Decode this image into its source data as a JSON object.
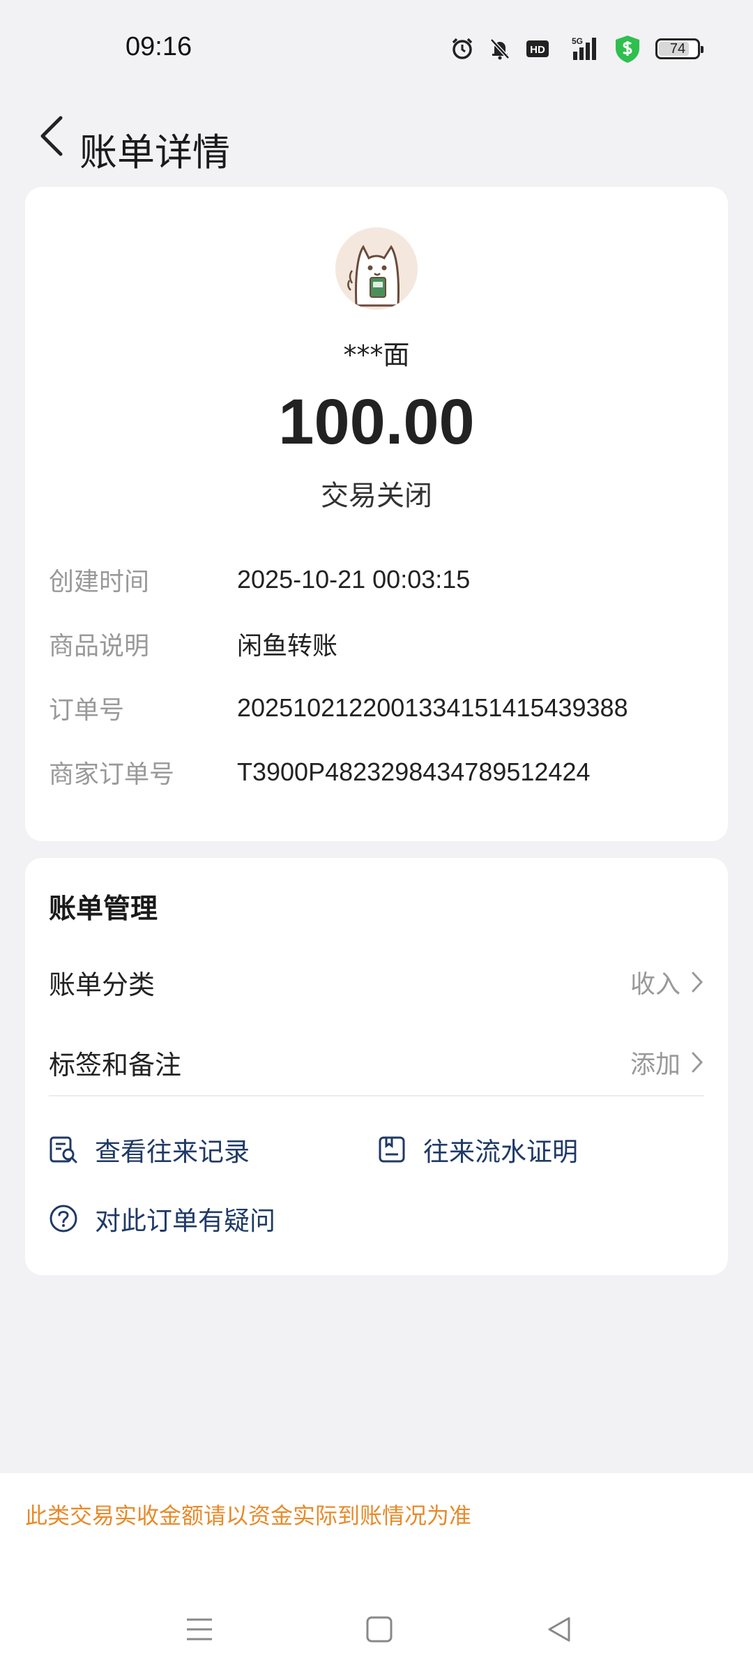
{
  "status_bar": {
    "time": "09:16",
    "icons": [
      "alarm-icon",
      "mute-bell-icon",
      "hd-icon",
      "5g-signal-icon",
      "shield-dollar-icon",
      "battery-icon"
    ],
    "hd_label": "HD",
    "network_label": "5G",
    "battery": "74",
    "battery_level": 0.74
  },
  "header": {
    "title": "账单详情"
  },
  "summary": {
    "payee": "***面",
    "amount": "100.00",
    "status": "交易关闭",
    "details": [
      {
        "label": "创建时间",
        "value": "2025-10-21 00:03:15"
      },
      {
        "label": "商品说明",
        "value": "闲鱼转账"
      },
      {
        "label": "订单号",
        "value": "2025102122001334151415439388"
      },
      {
        "label": "商家订单号",
        "value": "T3900P4823298434789512424"
      }
    ]
  },
  "manage": {
    "title": "账单管理",
    "rows": [
      {
        "label": "账单分类",
        "value": "收入"
      },
      {
        "label": "标签和备注",
        "value": "添加"
      }
    ],
    "links": [
      {
        "label": "查看往来记录",
        "icon": "record-search-icon"
      },
      {
        "label": "往来流水证明",
        "icon": "statement-icon"
      },
      {
        "label": "对此订单有疑问",
        "icon": "question-icon"
      }
    ]
  },
  "footer": {
    "notice": "此类交易实收金额请以资金实际到账情况为准"
  },
  "colors": {
    "background": "#f2f2f4",
    "link": "#1f3a66",
    "notice": "#e88a2a",
    "shield": "#2fbf4f"
  }
}
